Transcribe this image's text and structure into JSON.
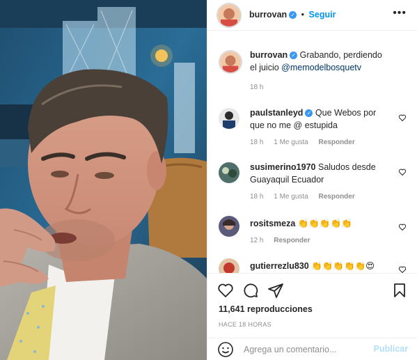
{
  "post": {
    "author": "burrovan",
    "follow_label": "Seguir",
    "more_icon": "more-options-icon"
  },
  "caption": {
    "username": "burrovan",
    "text": "Grabando, perdiendo el juicio",
    "mention": "@memodelbosquetv",
    "time": "18 h"
  },
  "comments": [
    {
      "username": "paulstanleyd",
      "verified": true,
      "text": "Que Webos por que no me @ estupida",
      "time": "18 h",
      "likes": "1 Me gusta",
      "reply": "Responder"
    },
    {
      "username": "susimerino1970",
      "verified": false,
      "text": "Saludos desde Guayaquil Ecuador",
      "time": "18 h",
      "likes": "1 Me gusta",
      "reply": "Responder"
    },
    {
      "username": "rositsmeza",
      "verified": false,
      "text": "👏👏👏👏👏",
      "time": "12 h",
      "likes": "",
      "reply": "Responder"
    },
    {
      "username": "gutierrezlu830",
      "verified": false,
      "text": "👏👏👏👏👏😍",
      "time": "",
      "likes": "",
      "reply": ""
    }
  ],
  "stats": {
    "views": "11,641 reproducciones",
    "time_ago": "HACE 18 HORAS"
  },
  "comment_box": {
    "placeholder": "Agrega un comentario...",
    "publish_label": "Publicar"
  },
  "icons": {
    "like": "heart-icon",
    "comment": "comment-icon",
    "share": "share-icon",
    "save": "bookmark-icon",
    "emoji": "emoji-icon"
  },
  "colors": {
    "accent": "#0095f6",
    "verified": "#3897f0",
    "muted": "#8e8e8e",
    "publish_disabled": "#b2dffc"
  }
}
